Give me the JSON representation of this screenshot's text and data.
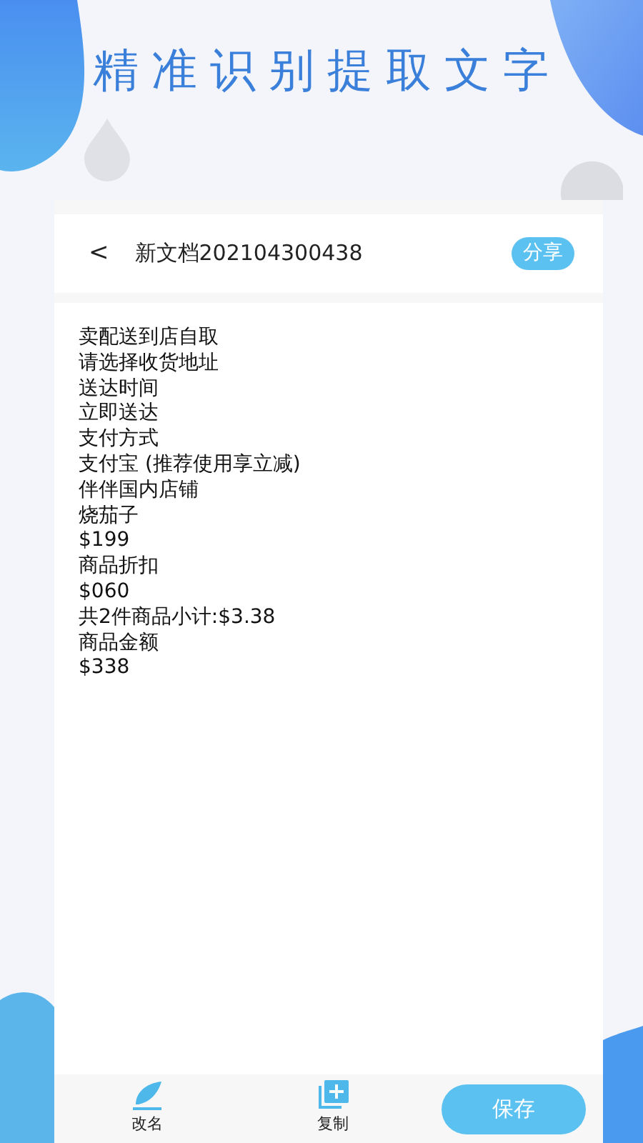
{
  "headline": "精准识别提取文字",
  "header": {
    "back": "<",
    "title": "新文档202104300438",
    "share": "分享"
  },
  "lines": [
    "卖配送到店自取",
    "请选择收货地址",
    "送达时间",
    "立即送达",
    "支付方式",
    "支付宝 (推荐使用享立减)",
    "伴伴国内店铺",
    "烧茄子",
    "$199",
    "商品折扣",
    "$060",
    "共2件商品小计:$3.38",
    "商品金额",
    "$338"
  ],
  "toolbar": [
    {
      "kind": "rename",
      "label": "改名"
    },
    {
      "kind": "copy",
      "label": "复制"
    }
  ],
  "save_button": "保存"
}
